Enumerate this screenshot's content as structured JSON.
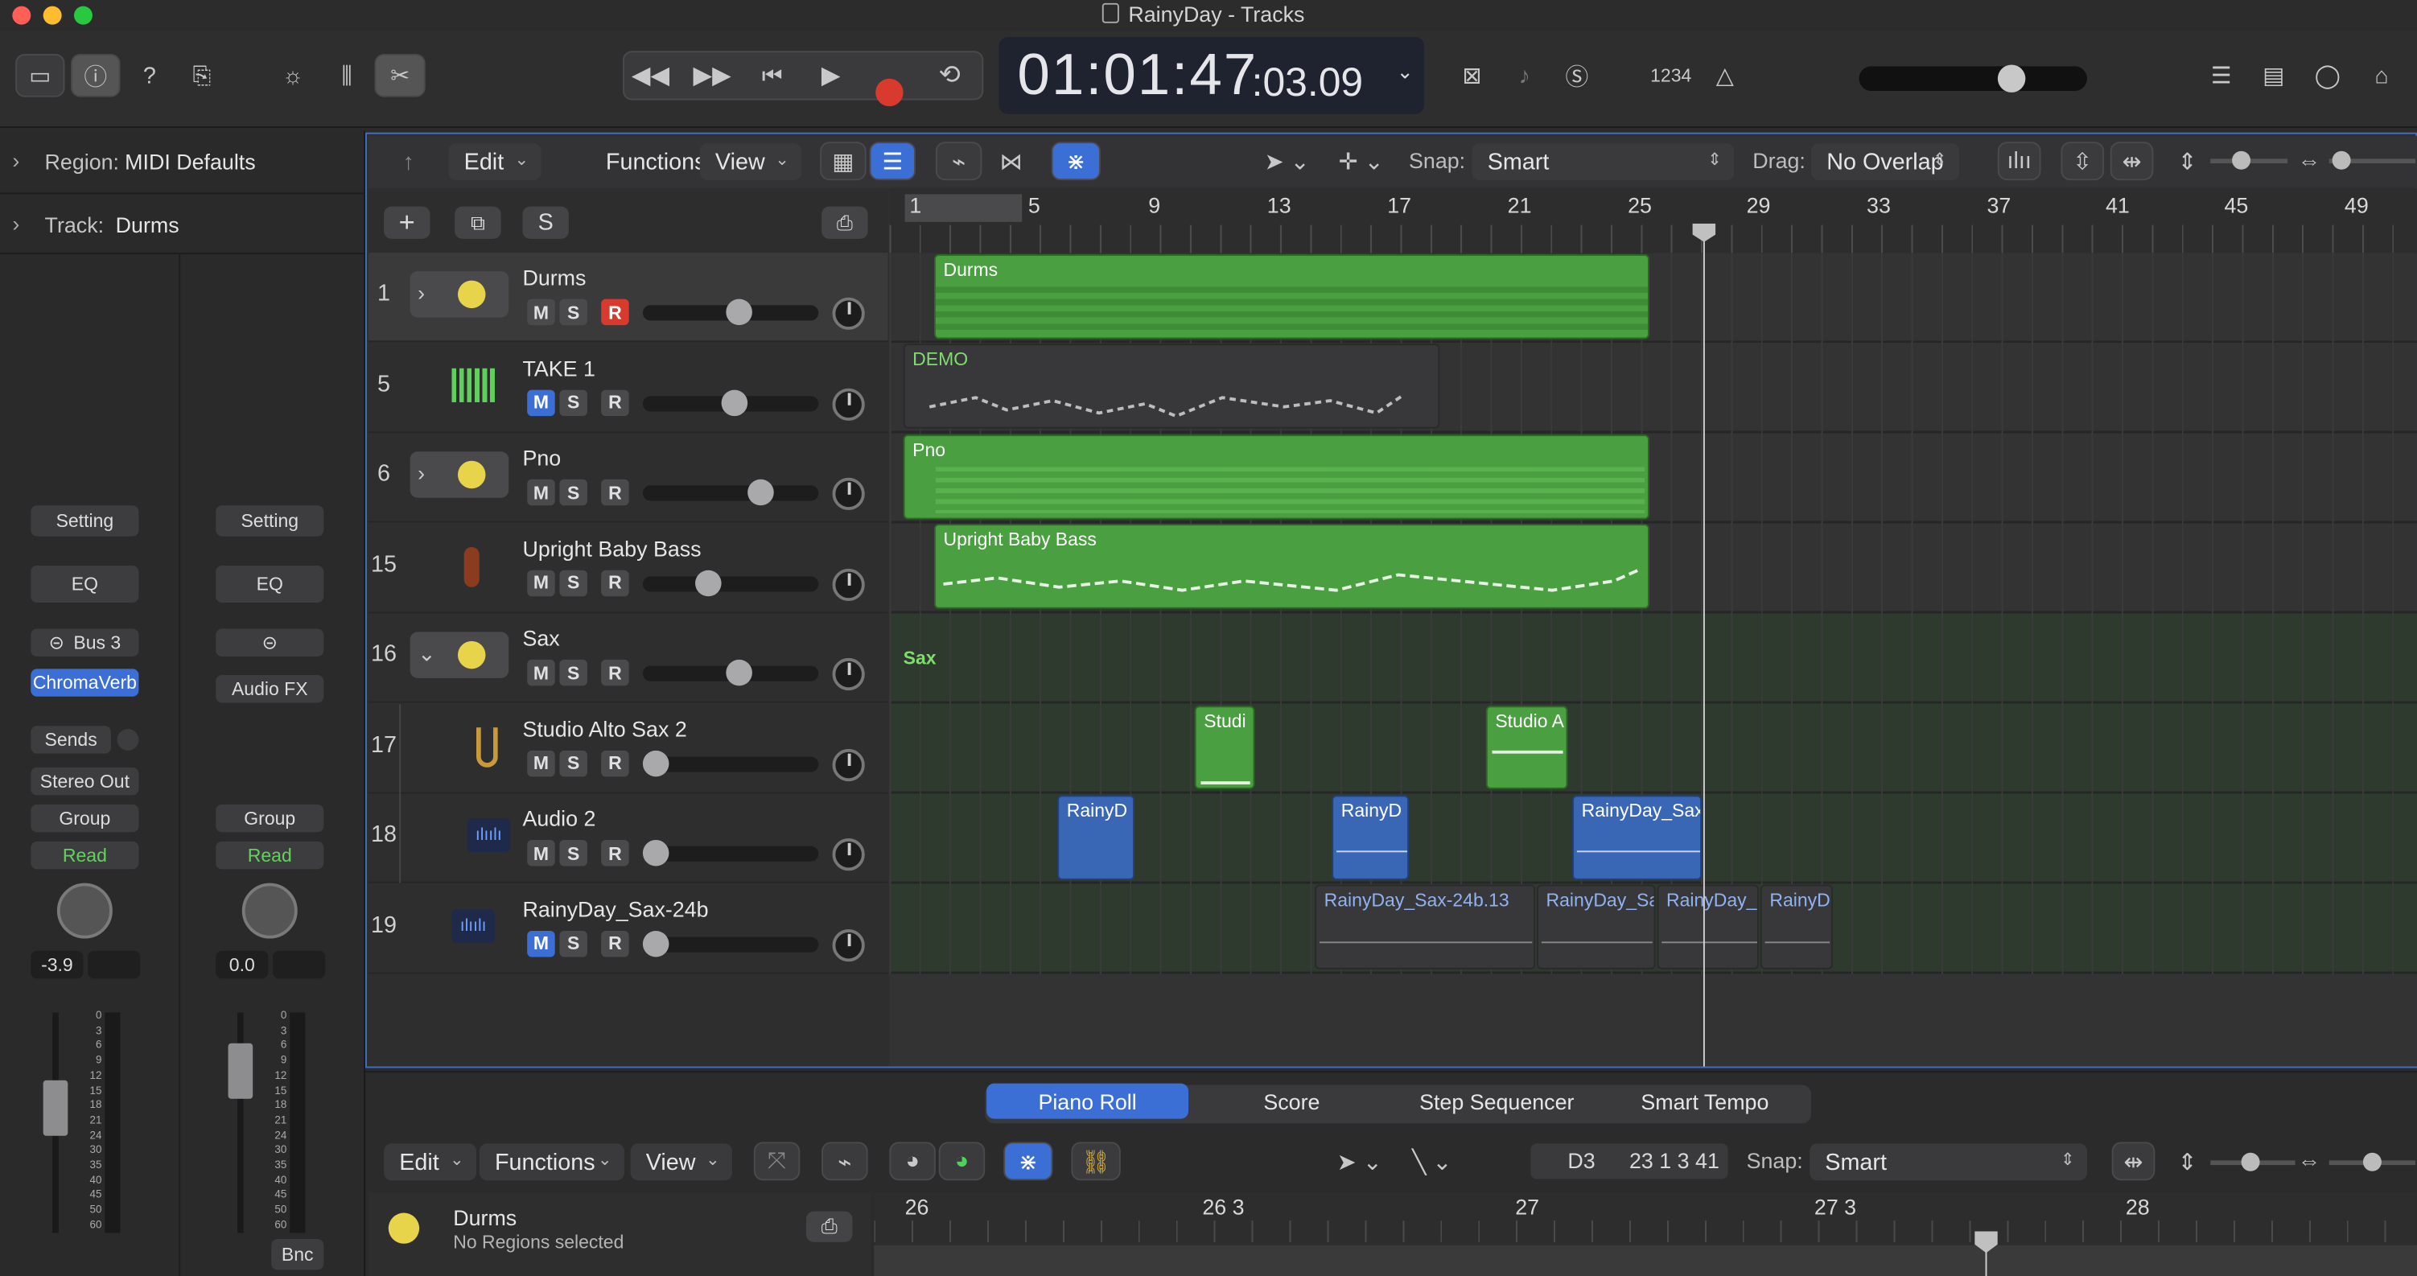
{
  "window": {
    "title": "RainyDay - Tracks"
  },
  "lcd": {
    "time": "01:01:47",
    "sub": ":03.09"
  },
  "control_bar": {
    "counter_label": "1234"
  },
  "inspector": {
    "region_prefix": "Region:",
    "region_value": "MIDI Defaults",
    "track_prefix": "Track:",
    "track_value": "Durms",
    "strip1": {
      "setting": "Setting",
      "eq": "EQ",
      "bus": "Bus 3",
      "plugin": "ChromaVerb",
      "sends": "Sends",
      "output": "Stereo Out",
      "group": "Group",
      "automation": "Read",
      "volume": "-3.9"
    },
    "strip2": {
      "setting": "Setting",
      "eq": "EQ",
      "audio_fx": "Audio FX",
      "group": "Group",
      "automation": "Read",
      "volume": "0.0",
      "bounce": "Bnc"
    },
    "meter_scale": [
      "0",
      "3",
      "6",
      "9",
      "12",
      "15",
      "18",
      "21",
      "24",
      "30",
      "35",
      "40",
      "45",
      "50",
      "60"
    ]
  },
  "tracks_toolbar": {
    "edit": "Edit",
    "functions": "Functions",
    "view": "View",
    "snap_label": "Snap:",
    "snap_value": "Smart",
    "drag_label": "Drag:",
    "drag_value": "No Overlap"
  },
  "track_header_buttons": {
    "add": "+",
    "solo": "S"
  },
  "ruler": [
    "1",
    "5",
    "9",
    "13",
    "17",
    "21",
    "25",
    "29",
    "33",
    "37",
    "41",
    "45",
    "49"
  ],
  "tracks": [
    {
      "num": "1",
      "name": "Durms",
      "icon": "drummer-icon",
      "mute": "M",
      "solo": "S",
      "rec": "R",
      "mute_active": false,
      "rec_active": true,
      "volume": 0.56
    },
    {
      "num": "5",
      "name": "TAKE 1",
      "icon": "keyboard-icon",
      "mute": "M",
      "solo": "S",
      "rec": "R",
      "mute_active": true,
      "rec_active": false,
      "volume": 0.53
    },
    {
      "num": "6",
      "name": "Pno",
      "icon": "drummer-icon",
      "mute": "M",
      "solo": "S",
      "rec": "R",
      "mute_active": false,
      "rec_active": false,
      "volume": 0.7
    },
    {
      "num": "15",
      "name": "Upright Baby Bass",
      "icon": "bass-icon",
      "mute": "M",
      "solo": "S",
      "rec": "R",
      "mute_active": false,
      "rec_active": false,
      "volume": 0.35
    },
    {
      "num": "16",
      "name": "Sax",
      "icon": "drummer-icon",
      "mute": "M",
      "solo": "S",
      "rec": "R",
      "mute_active": false,
      "rec_active": false,
      "volume": 0.56
    },
    {
      "num": "17",
      "name": "Studio Alto Sax 2",
      "icon": "sax-icon",
      "mute": "M",
      "solo": "S",
      "rec": "R",
      "mute_active": false,
      "rec_active": false,
      "volume": 0.0
    },
    {
      "num": "18",
      "name": "Audio 2",
      "icon": "waveform-icon",
      "mute": "M",
      "solo": "S",
      "rec": "R",
      "mute_active": false,
      "rec_active": false,
      "volume": 0.0
    },
    {
      "num": "19",
      "name": "RainyDay_Sax-24b",
      "icon": "waveform-icon",
      "mute": "M",
      "solo": "S",
      "rec": "R",
      "mute_active": true,
      "rec_active": false,
      "volume": 0.0
    }
  ],
  "regions": {
    "durms": "Durms",
    "demo": "DEMO",
    "pno": "Pno",
    "bass": "Upright Baby Bass",
    "sax_folder": "Sax",
    "studio1": "Studi",
    "studio2": "Studio A",
    "audio1": "RainyD",
    "audio2": "RainyD",
    "audio3": "RainyDay_Sax",
    "s24a": "RainyDay_Sax-24b.13",
    "s24b": "RainyDay_Sa",
    "s24c": "RainyDay_",
    "s24d": "RainyD"
  },
  "editor": {
    "tabs": [
      "Piano Roll",
      "Score",
      "Step Sequencer",
      "Smart Tempo"
    ],
    "edit": "Edit",
    "functions": "Functions",
    "view": "View",
    "note_display": "D3",
    "position_display": "23 1 3 41",
    "snap_label": "Snap:",
    "snap_value": "Smart",
    "track_name": "Durms",
    "status": "No Regions selected",
    "ruler": [
      "26",
      "26 3",
      "27",
      "27 3",
      "28"
    ]
  },
  "colors": {
    "region_green": "#4a9f40",
    "region_blue": "#3a67b5",
    "record_red": "#d83a2e",
    "accent_blue": "#3c6fd6"
  }
}
